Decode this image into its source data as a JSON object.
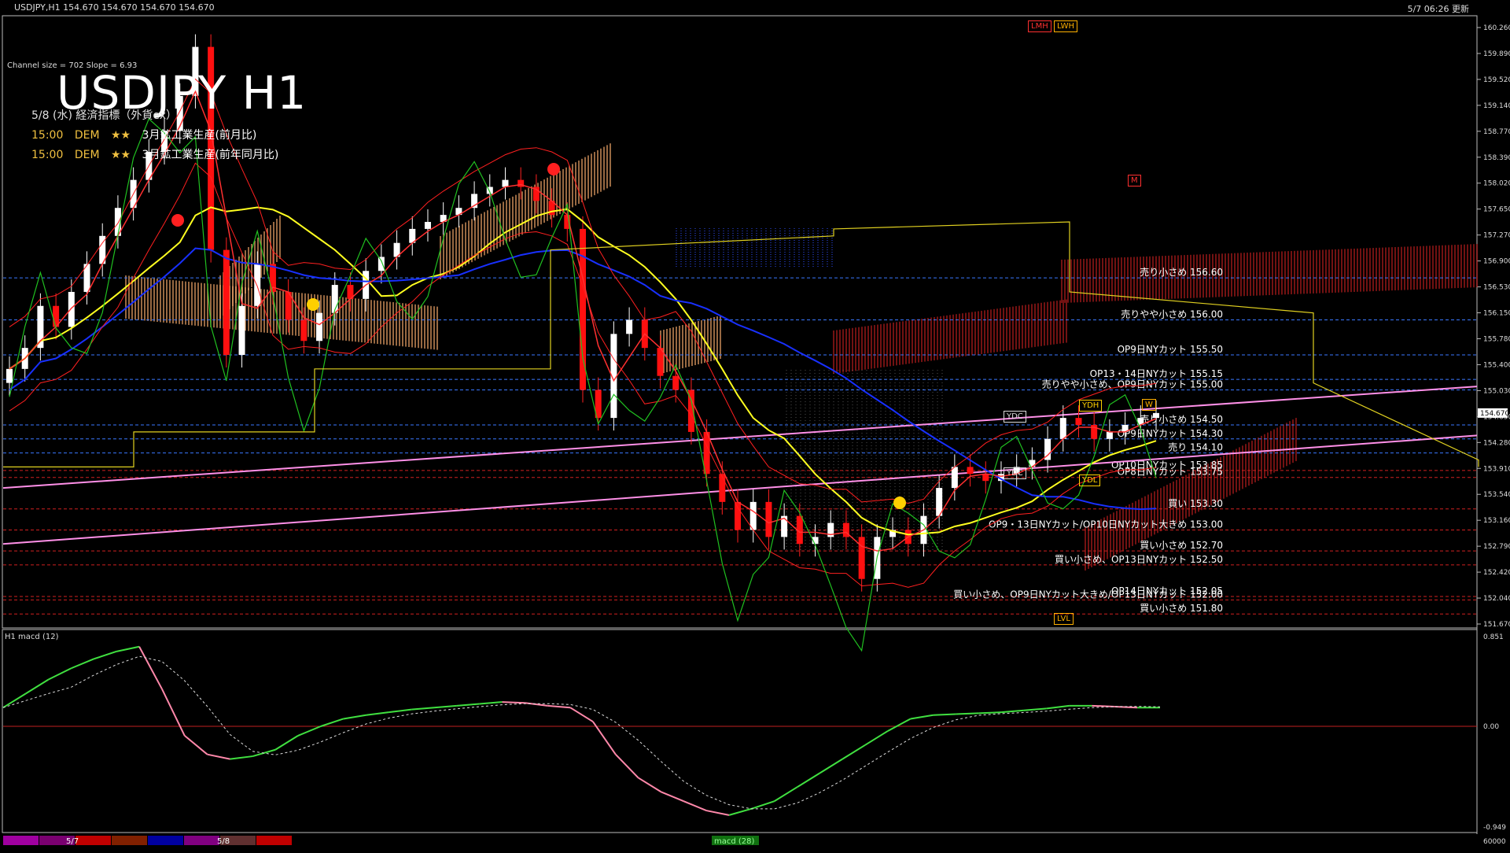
{
  "header": {
    "symbol_info": "USDJPY,H1 154.670 154.670 154.670 154.670",
    "timestamp": "5/7 06:26 更新",
    "channel_info": "Channel size = 702 Slope = 6.93",
    "title": "USDJPY H1"
  },
  "events": {
    "heading": "5/8 (水) 経済指標（外貨ex）",
    "items": [
      {
        "time": "15:00",
        "country": "DEM",
        "stars": "★★",
        "name": "3月鉱工業生産(前月比)"
      },
      {
        "time": "15:00",
        "country": "DEM",
        "stars": "★★",
        "name": "3月鉱工業生産(前年同月比)"
      }
    ]
  },
  "tags": {
    "lmh": "LMH",
    "lwh": "LWH",
    "m": "M",
    "ydc1": "YDC",
    "ydc2": "YDC",
    "ydh": "YDH",
    "ydl": "YDL",
    "lvl": "LVL",
    "w": "W",
    "u": "U"
  },
  "price_axis": {
    "current": "154.670",
    "labels": [
      "160.260",
      "159.890",
      "159.520",
      "159.140",
      "158.770",
      "158.390",
      "158.020",
      "157.650",
      "157.270",
      "156.900",
      "156.530",
      "156.150",
      "155.780",
      "155.400",
      "155.030",
      "154.650",
      "154.280",
      "153.910",
      "153.540",
      "153.160",
      "152.790",
      "152.420",
      "152.040",
      "151.670"
    ]
  },
  "levels": [
    {
      "label": "売り小さめ 156.60",
      "y": 156.6,
      "color": "#3a78ff"
    },
    {
      "label": "売りやや小さめ 156.00",
      "y": 156.0,
      "color": "#3a78ff"
    },
    {
      "label": "OP9日NYカット 155.50",
      "y": 155.5,
      "color": "#3a78ff"
    },
    {
      "label": "OP13・14日NYカット 155.15",
      "y": 155.15,
      "color": "#3a78ff"
    },
    {
      "label": "売りやや小さめ、OP9日NYカット 155.00",
      "y": 155.0,
      "color": "#3a78ff"
    },
    {
      "label": "売り小さめ 154.50",
      "y": 154.5,
      "color": "#3a78ff"
    },
    {
      "label": "OP9日NYカット 154.30",
      "y": 154.3,
      "color": "#3a78ff"
    },
    {
      "label": "売り 154.10",
      "y": 154.1,
      "color": "#3a78ff"
    },
    {
      "label": "OP10日NYカット 153.85",
      "y": 153.85,
      "color": "#d02020"
    },
    {
      "label": "OP8日NYカット 153.75",
      "y": 153.75,
      "color": "#d02020"
    },
    {
      "label": "買い 153.30",
      "y": 153.3,
      "color": "#d02020"
    },
    {
      "label": "OP9・13日NYカット/OP10日NYカット大きめ 153.00",
      "y": 153.0,
      "color": "#d02020"
    },
    {
      "label": "買い小さめ 152.70",
      "y": 152.7,
      "color": "#d02020"
    },
    {
      "label": "買い小さめ、OP13日NYカット 152.50",
      "y": 152.5,
      "color": "#d02020"
    },
    {
      "label": "OP14日NYカット 152.05",
      "y": 152.05,
      "color": "#d02020"
    },
    {
      "label": "買い小さめ、OP9日NYカット大きめ/OP13日NYカット 152.00",
      "y": 152.0,
      "color": "#d02020"
    },
    {
      "label": "買い小さめ 151.80",
      "y": 151.8,
      "color": "#d02020"
    }
  ],
  "macd": {
    "label": "H1 macd (12)",
    "axis_top": "0.851",
    "axis_zero": "0.00",
    "axis_bottom": "-0.949",
    "axis_foot": "60000"
  },
  "footer": {
    "date1": "5/7",
    "date2": "5/8",
    "macd_tab": "macd (28)"
  },
  "colors": {
    "ichimoku_cloud": "#ffb070",
    "ma_yellow": "#ffff20",
    "ma_blue": "#1830ff",
    "channel_pink": "#ff90e8",
    "bollinger_red": "#ff2020",
    "rsi_green": "#20c020"
  },
  "chart_data": {
    "type": "candlestick",
    "ylim": [
      151.6,
      160.3
    ],
    "closes": [
      155.3,
      155.6,
      156.2,
      155.9,
      156.4,
      156.8,
      157.2,
      157.6,
      158.0,
      158.4,
      158.7,
      159.2,
      159.9,
      157.0,
      155.5,
      156.2,
      156.8,
      156.4,
      156.0,
      155.7,
      156.1,
      156.5,
      156.3,
      156.7,
      156.9,
      157.1,
      157.3,
      157.4,
      157.5,
      157.6,
      157.8,
      157.9,
      158.0,
      157.9,
      157.7,
      157.5,
      157.3,
      155.0,
      154.6,
      155.8,
      156.0,
      155.6,
      155.2,
      155.0,
      154.4,
      153.8,
      153.4,
      153.0,
      153.4,
      152.9,
      153.2,
      152.8,
      152.9,
      153.1,
      152.9,
      152.3,
      152.9,
      153.0,
      152.8,
      153.2,
      153.6,
      153.9,
      153.8,
      153.7,
      153.8,
      153.9,
      154.0,
      154.3,
      154.6,
      154.5,
      154.3,
      154.4,
      154.5,
      154.6,
      154.67
    ],
    "macd_line": [
      0.2,
      0.35,
      0.5,
      0.62,
      0.72,
      0.8,
      0.851,
      0.4,
      -0.1,
      -0.3,
      -0.35,
      -0.32,
      -0.25,
      -0.1,
      0.0,
      0.08,
      0.12,
      0.15,
      0.18,
      0.2,
      0.22,
      0.24,
      0.26,
      0.25,
      0.22,
      0.2,
      0.05,
      -0.3,
      -0.55,
      -0.7,
      -0.8,
      -0.9,
      -0.949,
      -0.88,
      -0.8,
      -0.65,
      -0.5,
      -0.35,
      -0.2,
      -0.05,
      0.08,
      0.12,
      0.13,
      0.14,
      0.15,
      0.17,
      0.19,
      0.22,
      0.22,
      0.21,
      0.2,
      0.2
    ]
  }
}
